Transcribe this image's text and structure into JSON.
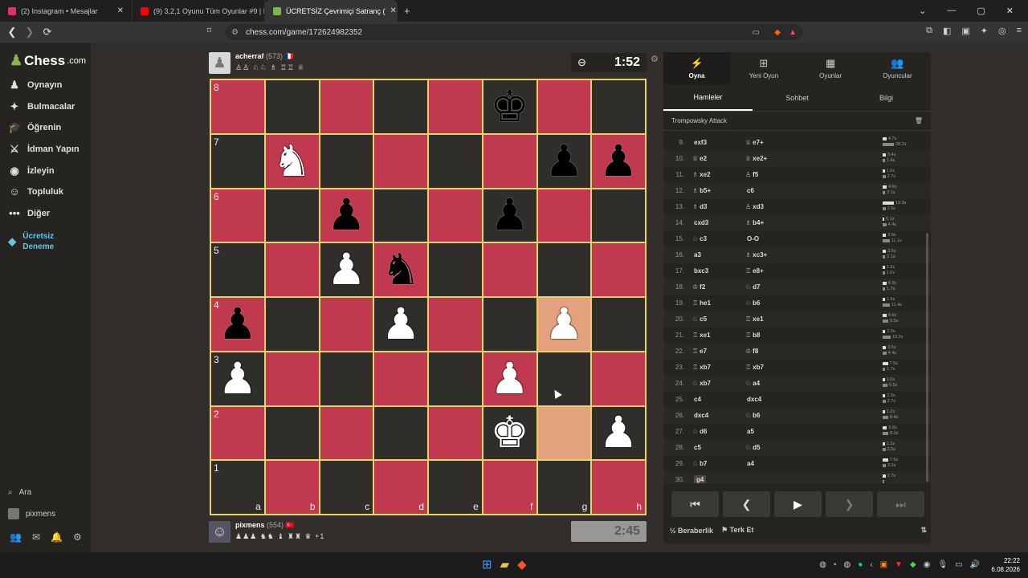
{
  "browser": {
    "tabs": [
      {
        "title": "(2) Instagram • Mesajlar",
        "color": "#e1306c",
        "active": false
      },
      {
        "title": "(9) 3,2,1 Oyunu Tüm Oyunlar #9 | Hı",
        "color": "#ff0000",
        "active": false
      },
      {
        "title": "ÜCRETSİZ Çevrimiçi Satranç (",
        "color": "#81b64c",
        "active": true
      }
    ],
    "url": "chess.com/game/172624982352"
  },
  "sidebar": {
    "logo_text": "Chess",
    "logo_suffix": ".com",
    "items": [
      {
        "label": "Oynayın",
        "icon": "♟"
      },
      {
        "label": "Bulmacalar",
        "icon": "✦"
      },
      {
        "label": "Öğrenin",
        "icon": "🎓"
      },
      {
        "label": "İdman Yapın",
        "icon": "⚔"
      },
      {
        "label": "İzleyin",
        "icon": "◉"
      },
      {
        "label": "Topluluk",
        "icon": "☺"
      },
      {
        "label": "Diğer",
        "icon": "•••"
      },
      {
        "label": "Ücretsiz Deneme",
        "icon": "◆"
      }
    ],
    "search_label": "Ara",
    "user_label": "pixmens"
  },
  "top_player": {
    "name": "acherraf",
    "rating": "(573)",
    "flag": "🇫🇷",
    "captured": "♙♙ ♘♘ ♗ ♖♖ ♕",
    "clock": "1:52"
  },
  "bottom_player": {
    "name": "pixmens",
    "rating": "(554)",
    "flag": "🇹🇷",
    "captured": "♟♟♟ ♞♞ ♝ ♜♜ ♛",
    "plus": "+1",
    "clock": "2:45"
  },
  "board": {
    "ranks": [
      "8",
      "7",
      "6",
      "5",
      "4",
      "3",
      "2",
      "1"
    ],
    "files": [
      "a",
      "b",
      "c",
      "d",
      "e",
      "f",
      "g",
      "h"
    ],
    "pieces": {
      "f8": "bk",
      "b7": "wn",
      "g7": "bp",
      "h7": "bp",
      "c6": "bp",
      "f6": "bp",
      "c5": "wp",
      "d5": "bn",
      "a4": "bp",
      "d4": "wp",
      "g4": "wp",
      "a3": "wp",
      "f3": "wp",
      "f2": "wk",
      "h2": "wp"
    },
    "highlighted": [
      "g4",
      "g2"
    ]
  },
  "panel": {
    "top_tabs": [
      {
        "label": "Oyna",
        "icon": "⚡"
      },
      {
        "label": "Yeni Oyun",
        "icon": "⊞"
      },
      {
        "label": "Oyunlar",
        "icon": "▦"
      },
      {
        "label": "Oyuncular",
        "icon": "👥"
      }
    ],
    "sub_tabs": [
      "Hamleler",
      "Sohbet",
      "Bilgi"
    ],
    "opening": "Trompowsky Attack",
    "moves": [
      {
        "n": "9.",
        "w": "exf3",
        "wp": "",
        "b": "e7+",
        "bp": "♕",
        "tw": "4.7s",
        "tb": "28.2s"
      },
      {
        "n": "10.",
        "w": "e2",
        "wp": "♕",
        "b": "xe2+",
        "bp": "♕",
        "tw": "3.4s",
        "tb": "1.4s"
      },
      {
        "n": "11.",
        "w": "xe2",
        "wp": "♗",
        "b": "f5",
        "bp": "♙",
        "tw": "1.0s",
        "tb": "2.7s"
      },
      {
        "n": "12.",
        "w": "b5+",
        "wp": "♗",
        "b": "c6",
        "bp": "",
        "tw": "4.9s",
        "tb": "2.1s"
      },
      {
        "n": "13.",
        "w": "d3",
        "wp": "♗",
        "b": "xd3",
        "bp": "♙",
        "tw": "19.9s",
        "tb": "2.5s"
      },
      {
        "n": "14.",
        "w": "cxd3",
        "wp": "",
        "b": "b4+",
        "bp": "♗",
        "tw": "0.1s",
        "tb": "4.4s"
      },
      {
        "n": "15.",
        "w": "c3",
        "wp": "♘",
        "b": "O-O",
        "bp": "",
        "tw": "3.8s",
        "tb": "11.1s"
      },
      {
        "n": "16.",
        "w": "a3",
        "wp": "",
        "b": "xc3+",
        "bp": "♗",
        "tw": "3.5s",
        "tb": "2.1s"
      },
      {
        "n": "17.",
        "w": "bxc3",
        "wp": "",
        "b": "e8+",
        "bp": "♖",
        "tw": "1.2s",
        "tb": "1.0s"
      },
      {
        "n": "18.",
        "w": "f2",
        "wp": "♔",
        "b": "d7",
        "bp": "♘",
        "tw": "4.3s",
        "tb": "1.7s"
      },
      {
        "n": "19.",
        "w": "he1",
        "wp": "♖",
        "b": "b6",
        "bp": "♘",
        "tw": "1.6s",
        "tb": "11.4s"
      },
      {
        "n": "20.",
        "w": "c5",
        "wp": "♘",
        "b": "xe1",
        "bp": "♖",
        "tw": "4.6s",
        "tb": "8.5s"
      },
      {
        "n": "21.",
        "w": "xe1",
        "wp": "♖",
        "b": "b8",
        "bp": "♖",
        "tw": "2.0s",
        "tb": "13.2s"
      },
      {
        "n": "22.",
        "w": "e7",
        "wp": "♖",
        "b": "f8",
        "bp": "♔",
        "tw": "3.5s",
        "tb": "4.4s"
      },
      {
        "n": "23.",
        "w": "xb7",
        "wp": "♖",
        "b": "xb7",
        "bp": "♖",
        "tw": "7.5s",
        "tb": "1.7s"
      },
      {
        "n": "24.",
        "w": "xb7",
        "wp": "♘",
        "b": "a4",
        "bp": "♘",
        "tw": "1.0s",
        "tb": "6.5s"
      },
      {
        "n": "25.",
        "w": "c4",
        "wp": "",
        "b": "dxc4",
        "bp": "",
        "tw": "2.0s",
        "tb": "2.7s"
      },
      {
        "n": "26.",
        "w": "dxc4",
        "wp": "",
        "b": "b6",
        "bp": "♘",
        "tw": "1.2s",
        "tb": "8.4s"
      },
      {
        "n": "27.",
        "w": "d6",
        "wp": "♘",
        "b": "a5",
        "bp": "",
        "tw": "5.8s",
        "tb": "8.6s"
      },
      {
        "n": "28.",
        "w": "c5",
        "wp": "",
        "b": "d5",
        "bp": "♘",
        "tw": "1.1s",
        "tb": "2.5s"
      },
      {
        "n": "29.",
        "w": "b7",
        "wp": "♘",
        "b": "a4",
        "bp": "",
        "tw": "7.9s",
        "tb": "3.3s"
      },
      {
        "n": "30.",
        "w": "g4",
        "wp": "",
        "b": "",
        "bp": "",
        "tw": "2.7s",
        "tb": ""
      }
    ],
    "controls": [
      "⏮",
      "❮",
      "▶",
      "❯",
      "⏭"
    ],
    "draw_label": "Beraberlik",
    "draw_icon": "½",
    "resign_label": "Terk Et",
    "resign_icon": "⚑"
  },
  "taskbar": {
    "time": "22:22",
    "date": "6.08.2026"
  }
}
